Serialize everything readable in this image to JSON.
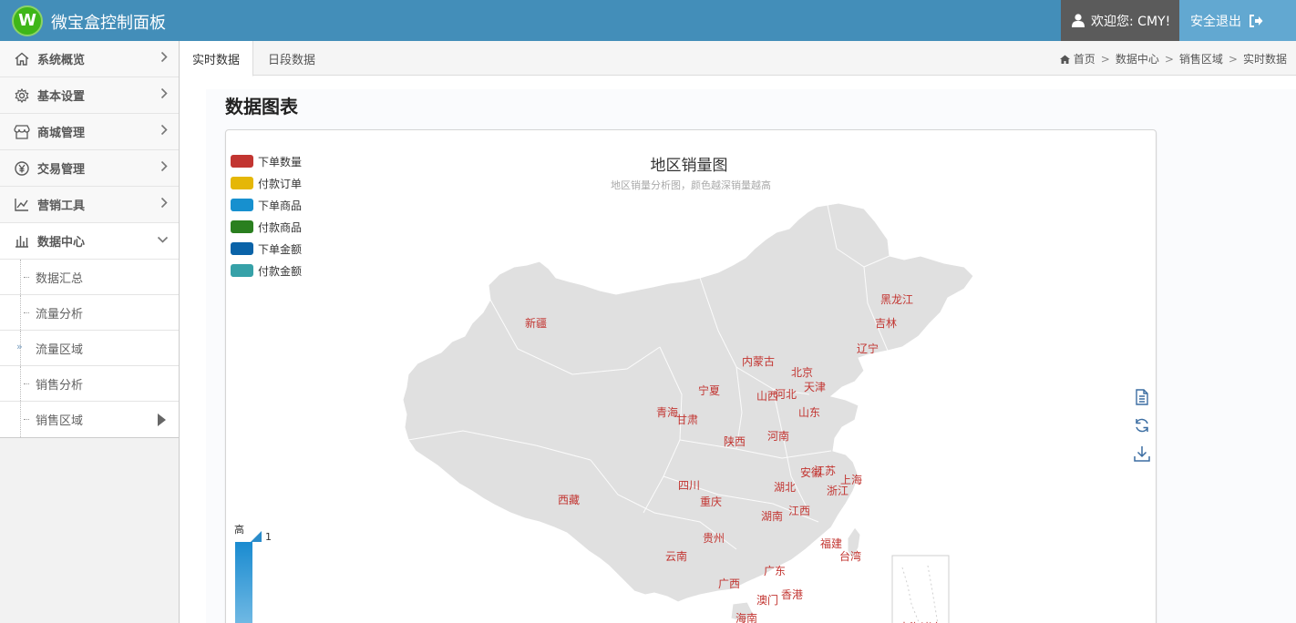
{
  "header": {
    "logo_letter": "W",
    "app_title": "微宝盒控制面板",
    "welcome": "欢迎您: CMY!",
    "logout": "安全退出"
  },
  "sidebar": {
    "items": [
      {
        "label": "系统概览",
        "icon": "home-icon"
      },
      {
        "label": "基本设置",
        "icon": "gear-icon"
      },
      {
        "label": "商城管理",
        "icon": "store-icon"
      },
      {
        "label": "交易管理",
        "icon": "yen-icon"
      },
      {
        "label": "营销工具",
        "icon": "line-chart-icon"
      },
      {
        "label": "数据中心",
        "icon": "bar-chart-icon",
        "expanded": true
      }
    ],
    "submenu": [
      {
        "label": "数据汇总"
      },
      {
        "label": "流量分析"
      },
      {
        "label": "流量区域",
        "marker": "»"
      },
      {
        "label": "销售分析"
      },
      {
        "label": "销售区域",
        "active": true
      }
    ]
  },
  "tabs": [
    {
      "label": "实时数据",
      "active": true
    },
    {
      "label": "日段数据",
      "active": false
    }
  ],
  "breadcrumb": [
    "首页",
    "数据中心",
    "销售区域",
    "实时数据"
  ],
  "breadcrumb_separator": ">",
  "section_title": "数据图表",
  "chart_data": {
    "type": "map",
    "title": "地区销量图",
    "subtitle": "地区销量分析图，颜色越深销量越高",
    "legend": [
      {
        "name": "下单数量",
        "color": "#c23531"
      },
      {
        "name": "付款订单",
        "color": "#e5b707"
      },
      {
        "name": "下单商品",
        "color": "#1790cf"
      },
      {
        "name": "付款商品",
        "color": "#2a7f1f"
      },
      {
        "name": "下单金额",
        "color": "#0a63a8"
      },
      {
        "name": "付款金额",
        "color": "#36a1a8"
      }
    ],
    "visual_map": {
      "high_label": "高",
      "max": "1",
      "colors": [
        "#1a8bd0",
        "#8dc8ea"
      ]
    },
    "regions": [
      "黑龙江",
      "吉林",
      "辽宁",
      "内蒙古",
      "北京",
      "天津",
      "河北",
      "山西",
      "宁夏",
      "新疆",
      "青海",
      "甘肃",
      "陕西",
      "山东",
      "河南",
      "江苏",
      "安徽",
      "上海",
      "浙江",
      "湖北",
      "四川",
      "重庆",
      "西藏",
      "江西",
      "湖南",
      "福建",
      "台湾",
      "贵州",
      "云南",
      "广西",
      "广东",
      "澳门",
      "香港",
      "海南",
      "南海诸岛"
    ],
    "region_color": "#e0e0e0",
    "label_color": "#c23531"
  },
  "toolbox": [
    "data-view-icon",
    "restore-icon",
    "save-image-icon"
  ]
}
